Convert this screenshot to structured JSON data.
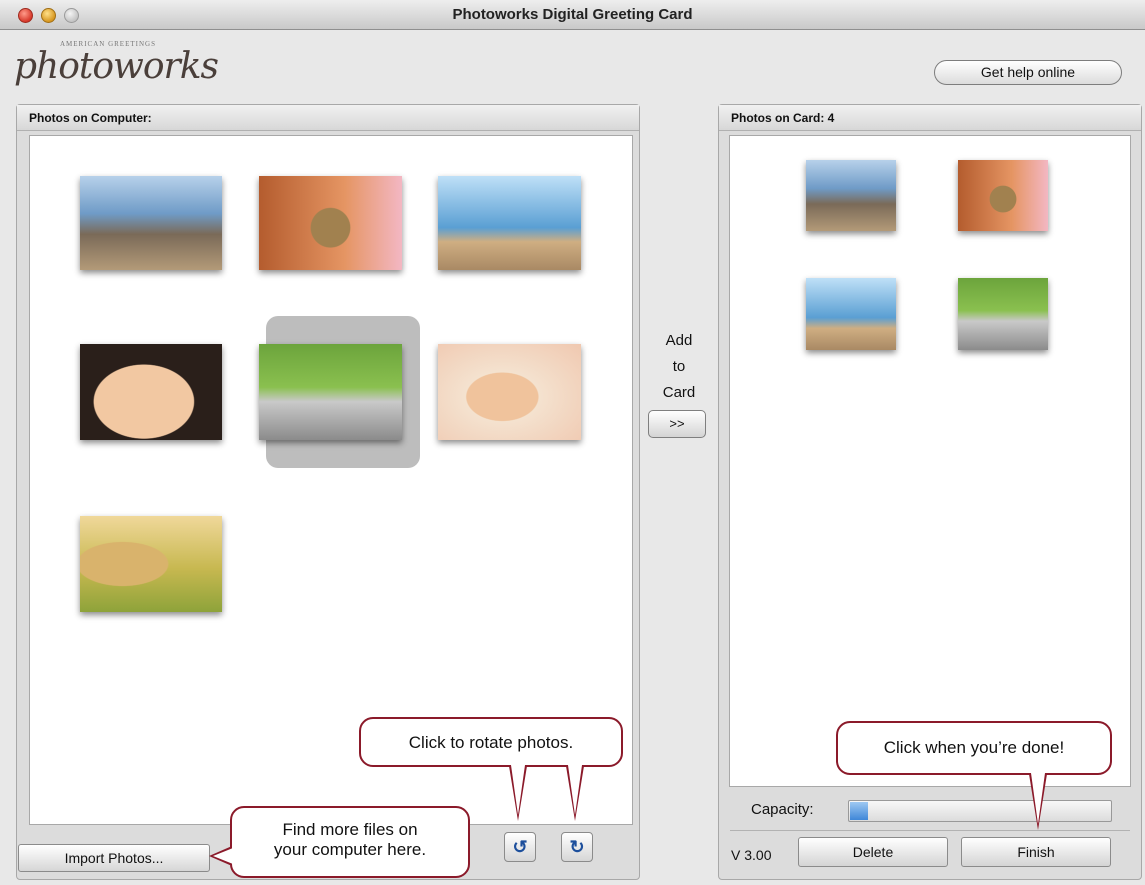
{
  "window": {
    "title": "Photoworks Digital Greeting Card"
  },
  "header": {
    "logo_tagline": "AMERICAN GREETINGS",
    "logo_text": "photoworks",
    "help_label": "Get help online"
  },
  "left_panel": {
    "title": "Photos on Computer:",
    "photos": [
      {
        "name": "golden-retriever-on-beach"
      },
      {
        "name": "kitten"
      },
      {
        "name": "child-at-beach"
      },
      {
        "name": "laughing-baby"
      },
      {
        "name": "child-on-tricycle",
        "selected": true
      },
      {
        "name": "crawling-baby"
      },
      {
        "name": "boy-with-puppy"
      }
    ]
  },
  "middle": {
    "add_label_line1": "Add",
    "add_label_line2": "to",
    "add_label_line3": "Card",
    "add_button_label": ">>"
  },
  "right_panel": {
    "title": "Photos on Card: 4",
    "capacity_label": "Capacity:",
    "capacity_value": 0.07,
    "version": "V 3.00",
    "delete_label": "Delete",
    "finish_label": "Finish"
  },
  "bottom": {
    "import_label": "Import Photos...",
    "rotate_left_icon": "rotate-left-icon",
    "rotate_right_icon": "rotate-right-icon"
  },
  "callouts": {
    "rotate": "Click to rotate photos.",
    "finish": "Click when you’re done!",
    "import_line1": "Find more files on",
    "import_line2": "your computer here."
  },
  "colors": {
    "callout_border": "#8b1a2a",
    "capacity_fill": "#3f87d8"
  }
}
